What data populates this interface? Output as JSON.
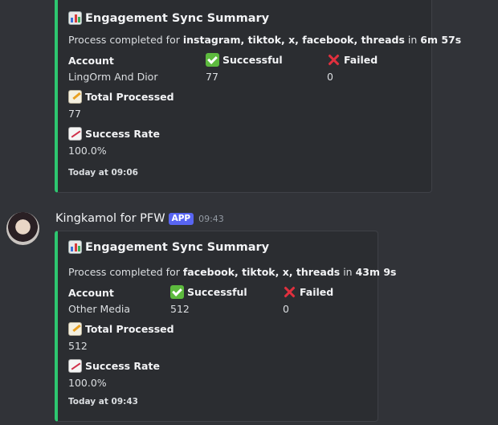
{
  "messages": [
    {
      "embed": {
        "title": "Engagement Sync Summary",
        "title_icon": "bar-chart-icon",
        "desc_prefix": "Process completed for ",
        "platforms": "instagram, tiktok, x, facebook, threads",
        "desc_in": " in ",
        "duration": "6m 57s",
        "fields": {
          "account_label": "Account",
          "account_value": "LingOrm And Dior",
          "successful_label": "Successful",
          "successful_value": "77",
          "failed_label": "Failed",
          "failed_value": "0",
          "total_label": "Total Processed",
          "total_value": "77",
          "rate_label": "Success Rate",
          "rate_value": "100.0%"
        },
        "footer": "Today at 09:06"
      }
    },
    {
      "author": "Kingkamol for PFW",
      "app_tag": "APP",
      "timestamp": "09:43",
      "embed": {
        "title": "Engagement Sync Summary",
        "title_icon": "bar-chart-icon",
        "desc_prefix": "Process completed for ",
        "platforms": "facebook, tiktok, x, threads",
        "desc_in": " in ",
        "duration": "43m 9s",
        "fields": {
          "account_label": "Account",
          "account_value": "Other Media",
          "successful_label": "Successful",
          "successful_value": "512",
          "failed_label": "Failed",
          "failed_value": "0",
          "total_label": "Total Processed",
          "total_value": "512",
          "rate_label": "Success Rate",
          "rate_value": "100.0%"
        },
        "footer": "Today at 09:43"
      }
    }
  ],
  "colors": {
    "background": "#313338",
    "embed_bg": "#2b2d31",
    "embed_accent": "#2dc770",
    "app_tag": "#5865f2"
  }
}
